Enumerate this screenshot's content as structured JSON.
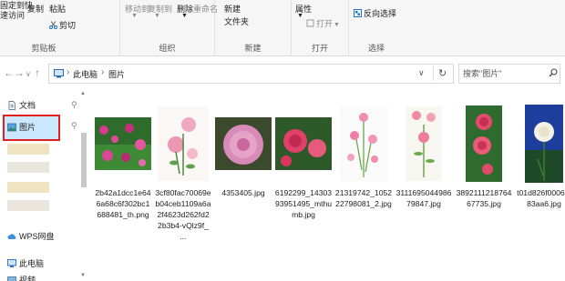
{
  "ribbon": {
    "pin_label": "固定到快",
    "pin_label2": "速访问",
    "copy": "复制",
    "paste": "粘贴",
    "cut": "剪切",
    "clipboard_group": "剪贴板",
    "move_to": "移动到",
    "copy_to": "复制到",
    "delete": "删除",
    "rename": "重命名",
    "organize_group": "组织",
    "new_folder": "新建",
    "new_folder2": "文件夹",
    "new_group": "新建",
    "properties": "属性",
    "open": "打开",
    "open_group": "打开",
    "invert_selection": "反向选择",
    "select_group": "选择"
  },
  "address": {
    "segments": [
      "此电脑",
      "图片"
    ]
  },
  "search": {
    "placeholder": "搜索\"图片\""
  },
  "nav": {
    "documents": "文档",
    "pictures": "图片",
    "wps": "WPS网盘",
    "this_pc": "此电脑",
    "videos": "视频"
  },
  "files": [
    {
      "name": "2b42a1dcc1e646a68c6f302bc1688481_th.png",
      "lines": [
        "2b42a1dcc1e64",
        "6a68c6f302bc1",
        "688481_th.png"
      ]
    },
    {
      "name": "3cf80fac70069eb04ceb1109a6a2f4623d262fd22b3b4-vQlz9f_...",
      "lines": [
        "3cf80fac70069e",
        "b04ceb1109a6a",
        "2f4623d262fd2",
        "2b3b4-vQlz9f_",
        "..."
      ]
    },
    {
      "name": "4353405.jpg",
      "lines": [
        "4353405.jpg"
      ]
    },
    {
      "name": "6192299_1430393951495_mthumb.jpg",
      "lines": [
        "6192299_14303",
        "93951495_mthu",
        "mb.jpg"
      ]
    },
    {
      "name": "21319742_105222798081_2.jpg",
      "lines": [
        "21319742_1052",
        "22798081_2.jpg"
      ]
    },
    {
      "name": "311169504498679847.jpg",
      "lines": [
        "3111695044986",
        "79847.jpg"
      ]
    },
    {
      "name": "389211121876467735.jpg",
      "lines": [
        "3892111218764",
        "67735.jpg"
      ]
    },
    {
      "name": "t01d826f00068f83aa6.jpg",
      "lines": [
        "t01d826f00068f",
        "83aa6.jpg"
      ]
    }
  ],
  "colors": {
    "selection_outline": "#e02020",
    "selection_fill": "#cce8ff",
    "accent": "#1a73c8"
  }
}
